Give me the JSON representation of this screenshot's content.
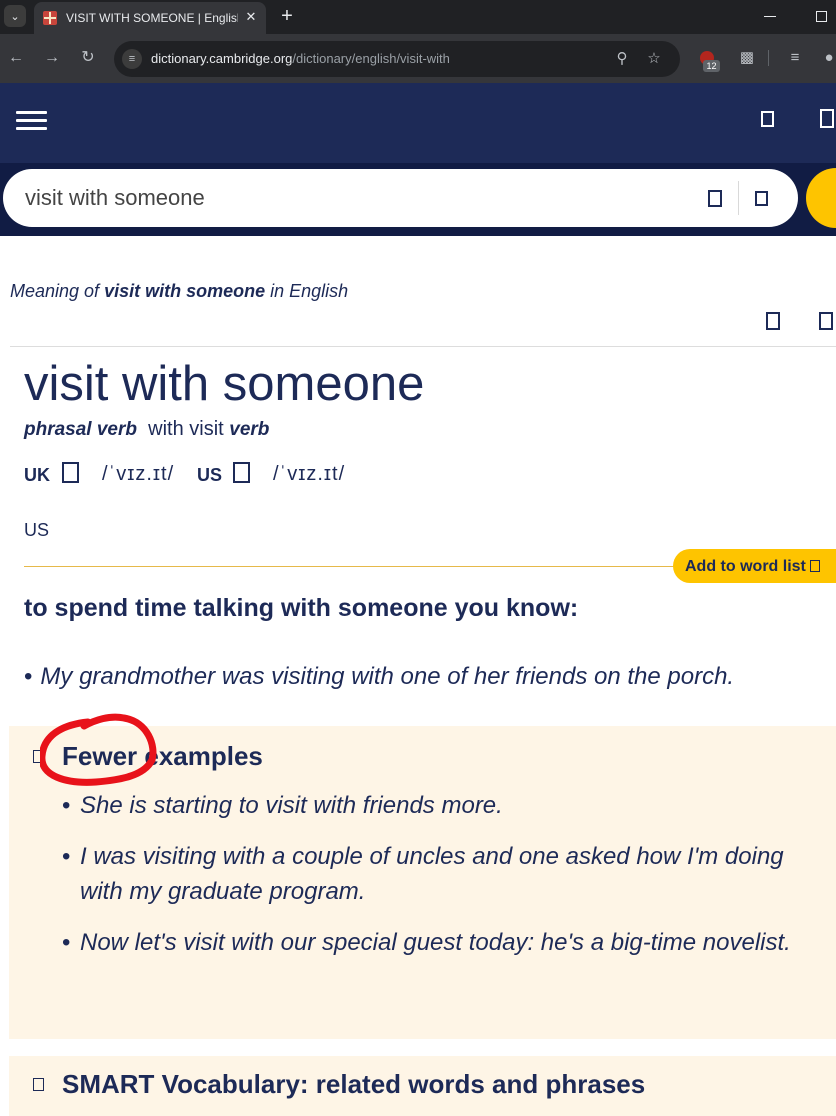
{
  "browser": {
    "tab_menu_icon": "chevron-down-icon",
    "tab_title": "VISIT WITH SOMEONE | English",
    "tab_close": "✕",
    "new_tab": "+",
    "url_host": "dictionary.cambridge.org",
    "url_path": "/dictionary/english/visit-with",
    "extension_badge": "12"
  },
  "header": {
    "menu_icon": "hamburger-icon"
  },
  "search": {
    "value": "visit with someone"
  },
  "entry": {
    "meaning_prefix": "Meaning of ",
    "meaning_term": "visit with someone",
    "meaning_suffix": " in English",
    "headword": "visit with someone",
    "pos": "phrasal verb",
    "related_text": "with visit",
    "related_pos": "verb",
    "uk_label": "UK",
    "uk_ipa": "/ˈvɪz.ɪt/",
    "us_label": "US",
    "us_ipa": "/ˈvɪz.ɪt/",
    "region_label": "US",
    "add_to_word_list": "Add to word list",
    "definition": "to spend time talking with someone you know:",
    "example": "My grandmother was visiting with one of her friends on the porch."
  },
  "more_examples": {
    "title": "Fewer examples",
    "items": [
      "She is starting to visit with friends more.",
      "I was visiting with a couple of uncles and one asked how I'm doing with my graduate program.",
      "Now let's visit with our special guest today: he's a big-time novelist."
    ]
  },
  "smart_vocab": {
    "title": "SMART Vocabulary: related words and phrases"
  },
  "colors": {
    "brand_navy": "#1d2a57",
    "brand_yellow": "#fec400",
    "examples_bg": "#fef5e6",
    "annotation_red": "#e8121a"
  }
}
